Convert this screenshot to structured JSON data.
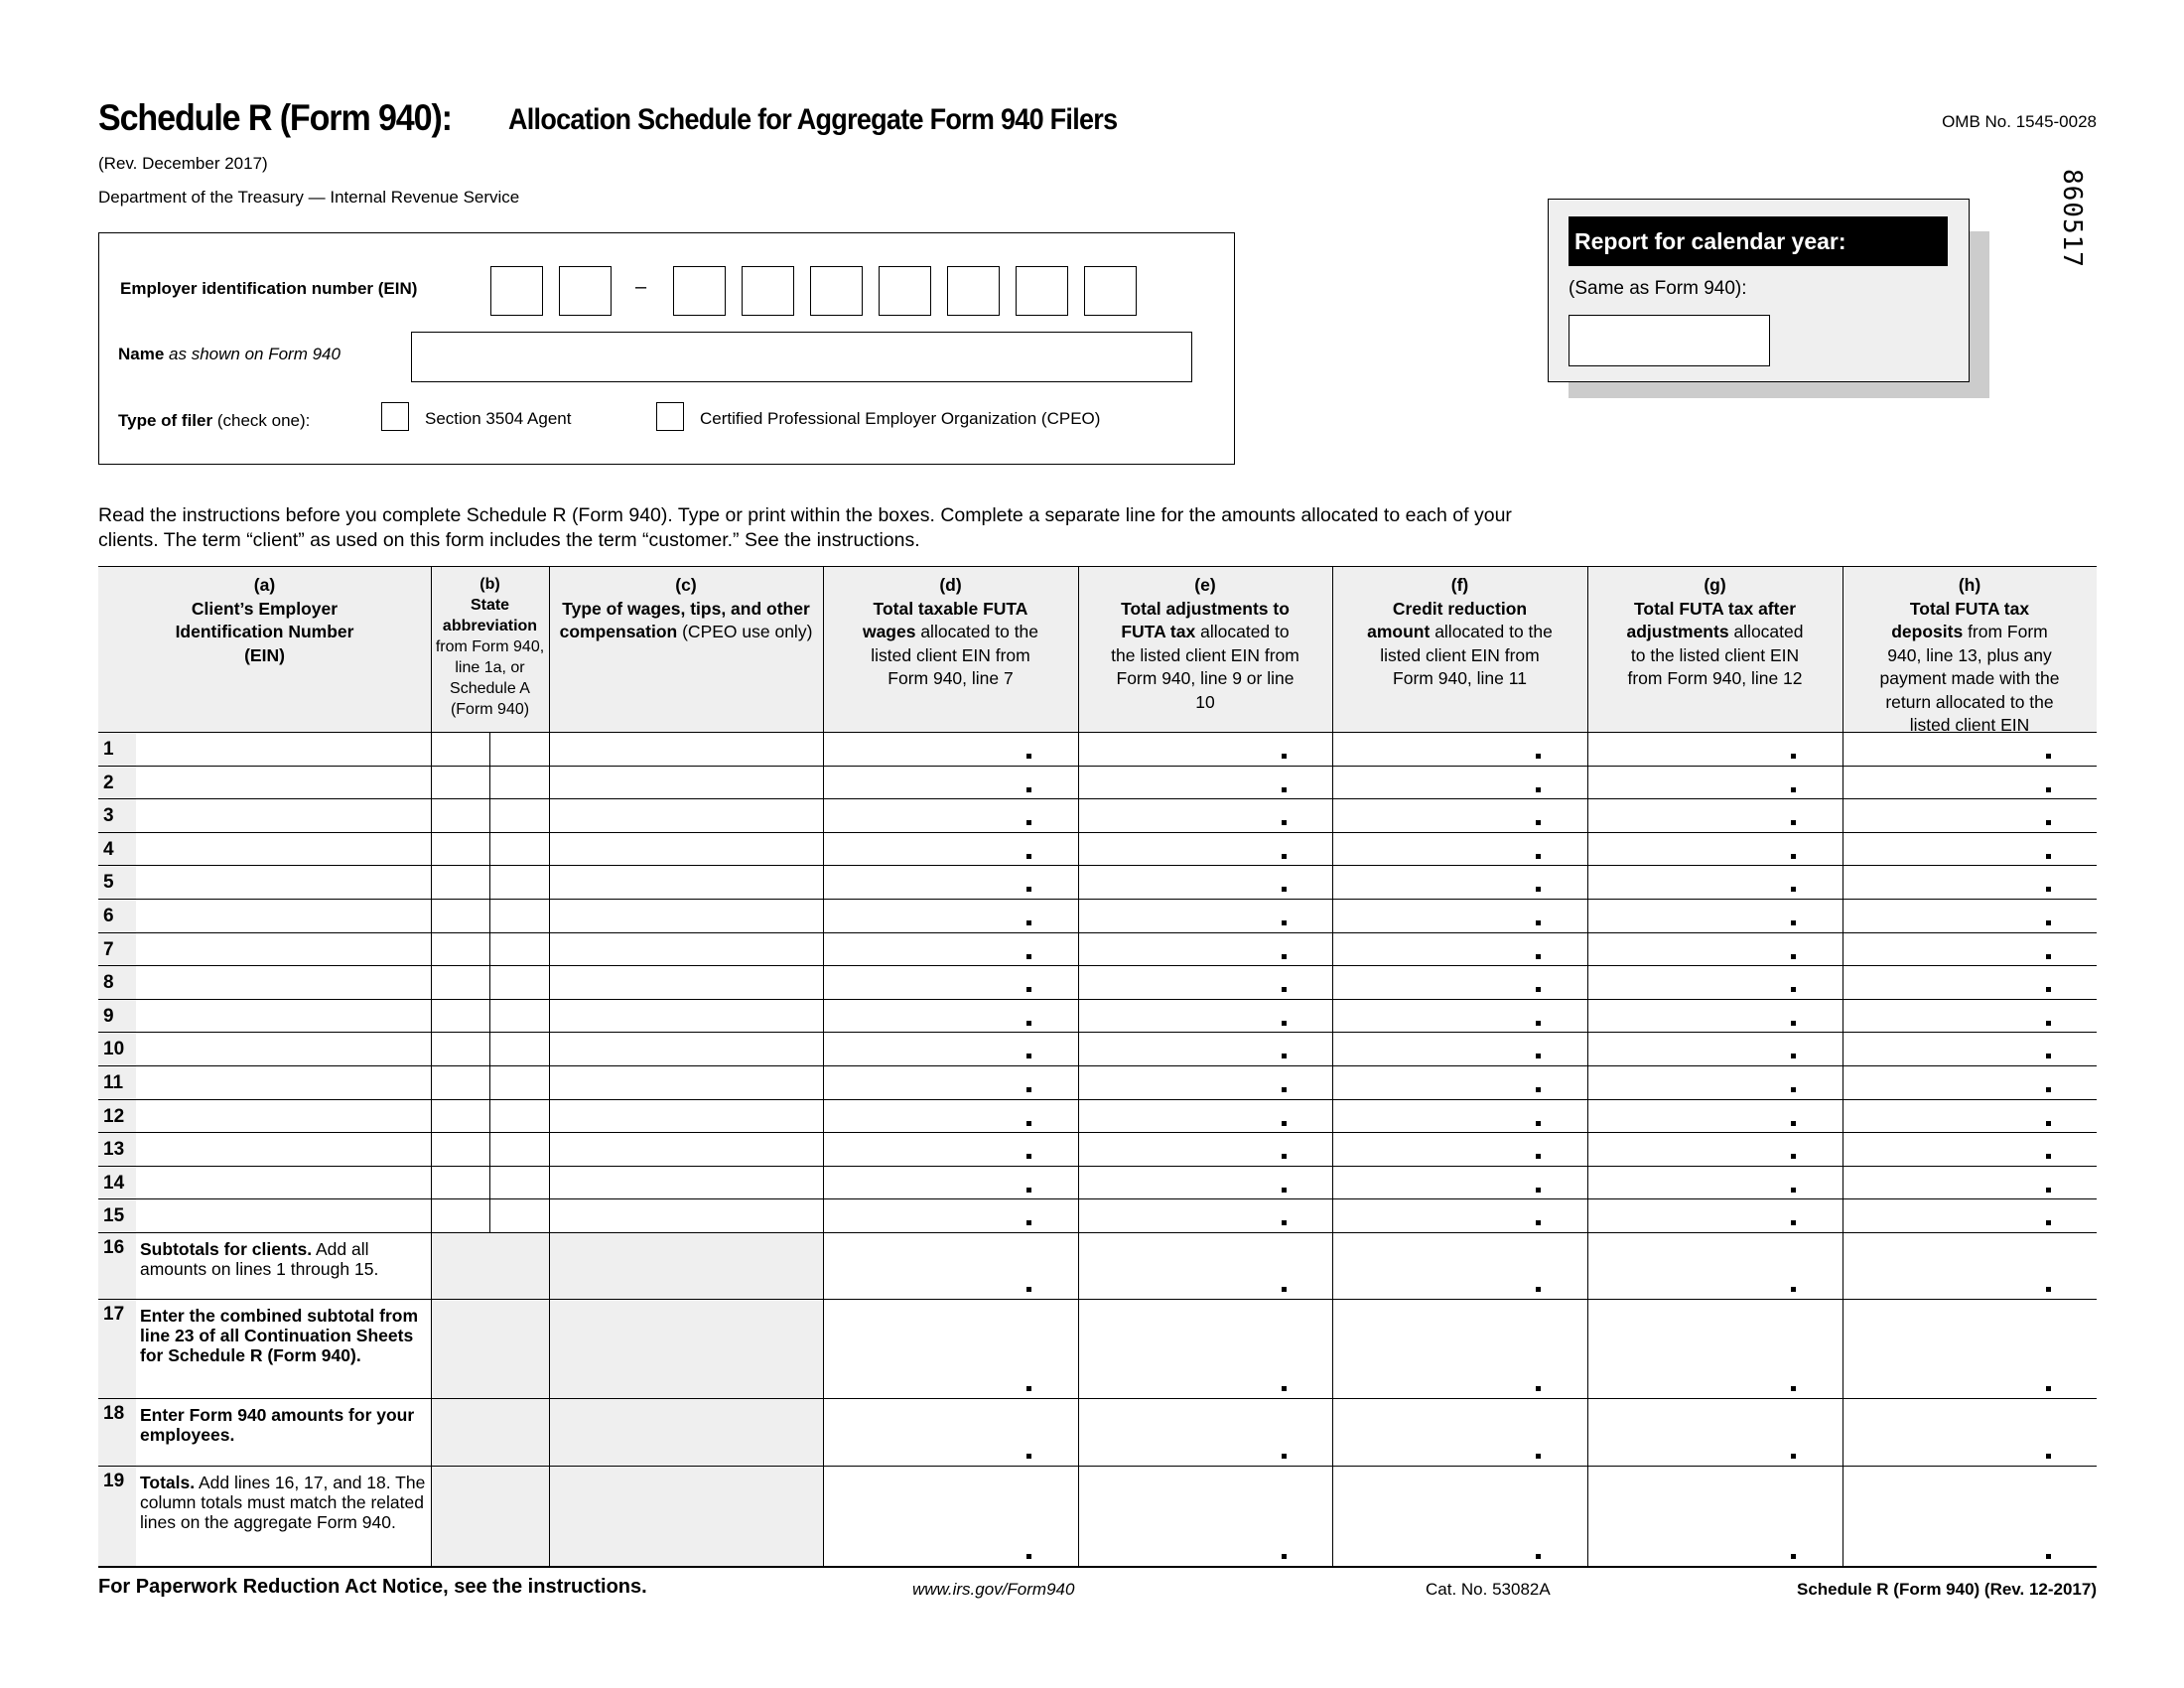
{
  "header": {
    "form_name": "Schedule R (Form 940):",
    "form_title": "Allocation Schedule for Aggregate Form 940 Filers",
    "revision": "(Rev. December 2017)",
    "department": "Department of the Treasury — Internal Revenue Service",
    "omb": "OMB No. 1545-0028",
    "vertical_code": "860517"
  },
  "employer": {
    "ein_label": "Employer identification number (EIN)",
    "ein_digits_before_dash": 2,
    "ein_digits_after_dash": 7,
    "ein_dash": "–",
    "ein_values": [
      "",
      "",
      "",
      "",
      "",
      "",
      "",
      "",
      ""
    ],
    "name_label_bold": "Name",
    "name_label_italic": "as shown on Form 940",
    "name_value": "",
    "filer_label_bold": "Type of filer",
    "filer_label_rest": "(check one):",
    "filer_options": [
      {
        "label": "Section 3504 Agent",
        "checked": false
      },
      {
        "label": "Certified Professional Employer Organization (CPEO)",
        "checked": false
      }
    ]
  },
  "calendar": {
    "heading": "Report for calendar year:",
    "subtext": "(Same as Form 940):",
    "year_value": ""
  },
  "instructions": "Read the instructions before you complete Schedule R (Form 940). Type or print within the boxes. Complete a separate line for the amounts allocated to each of your clients. The term “client” as used on this form includes the term “customer.” See the instructions.",
  "table": {
    "columns": [
      {
        "letter": "(a)",
        "bold": "Client’s Employer Identification Number (EIN)",
        "rest": ""
      },
      {
        "letter": "(b)",
        "bold": "State abbreviation",
        "rest": "from Form 940, line 1a, or Schedule A (Form 940)"
      },
      {
        "letter": "(c)",
        "bold": "Type of wages, tips, and other compensation",
        "rest": "(CPEO use only)"
      },
      {
        "letter": "(d)",
        "bold": "Total taxable FUTA wages",
        "rest": "allocated to the listed client EIN from Form 940, line 7"
      },
      {
        "letter": "(e)",
        "bold": "Total adjustments to FUTA tax",
        "rest": "allocated to the listed client EIN from Form 940, line 9 or line 10"
      },
      {
        "letter": "(f)",
        "bold": "Credit reduction amount",
        "rest": "allocated to the listed client EIN from Form 940, line 11"
      },
      {
        "letter": "(g)",
        "bold": "Total FUTA tax after adjustments",
        "rest": "allocated to the listed client EIN from Form 940, line 12"
      },
      {
        "letter": "(h)",
        "bold": "Total FUTA tax deposits",
        "rest": "from Form 940, line 13, plus any payment made with the return allocated to the listed client EIN"
      }
    ],
    "client_lines": [
      "1",
      "2",
      "3",
      "4",
      "5",
      "6",
      "7",
      "8",
      "9",
      "10",
      "11",
      "12",
      "13",
      "14",
      "15"
    ],
    "summary_lines": [
      {
        "num": "16",
        "bold": "Subtotals for clients.",
        "rest": " Add all amounts on lines 1 through 15."
      },
      {
        "num": "17",
        "bold": "Enter the combined subtotal from line 23 of all Continuation Sheets for Schedule R (Form 940).",
        "rest": ""
      },
      {
        "num": "18",
        "bold": "Enter Form 940 amounts for your employees.",
        "rest": ""
      },
      {
        "num": "19",
        "bold": "Totals.",
        "rest": " Add lines 16, 17, and 18. The column totals must match the related lines on the aggregate Form 940."
      }
    ],
    "decimal_marker": "."
  },
  "footer": {
    "paperwork": "For Paperwork Reduction Act Notice, see the instructions.",
    "url": "www.irs.gov/Form940",
    "cat_no": "Cat. No. 53082A",
    "form_id": "Schedule R (Form 940) (Rev. 12-2017)"
  }
}
